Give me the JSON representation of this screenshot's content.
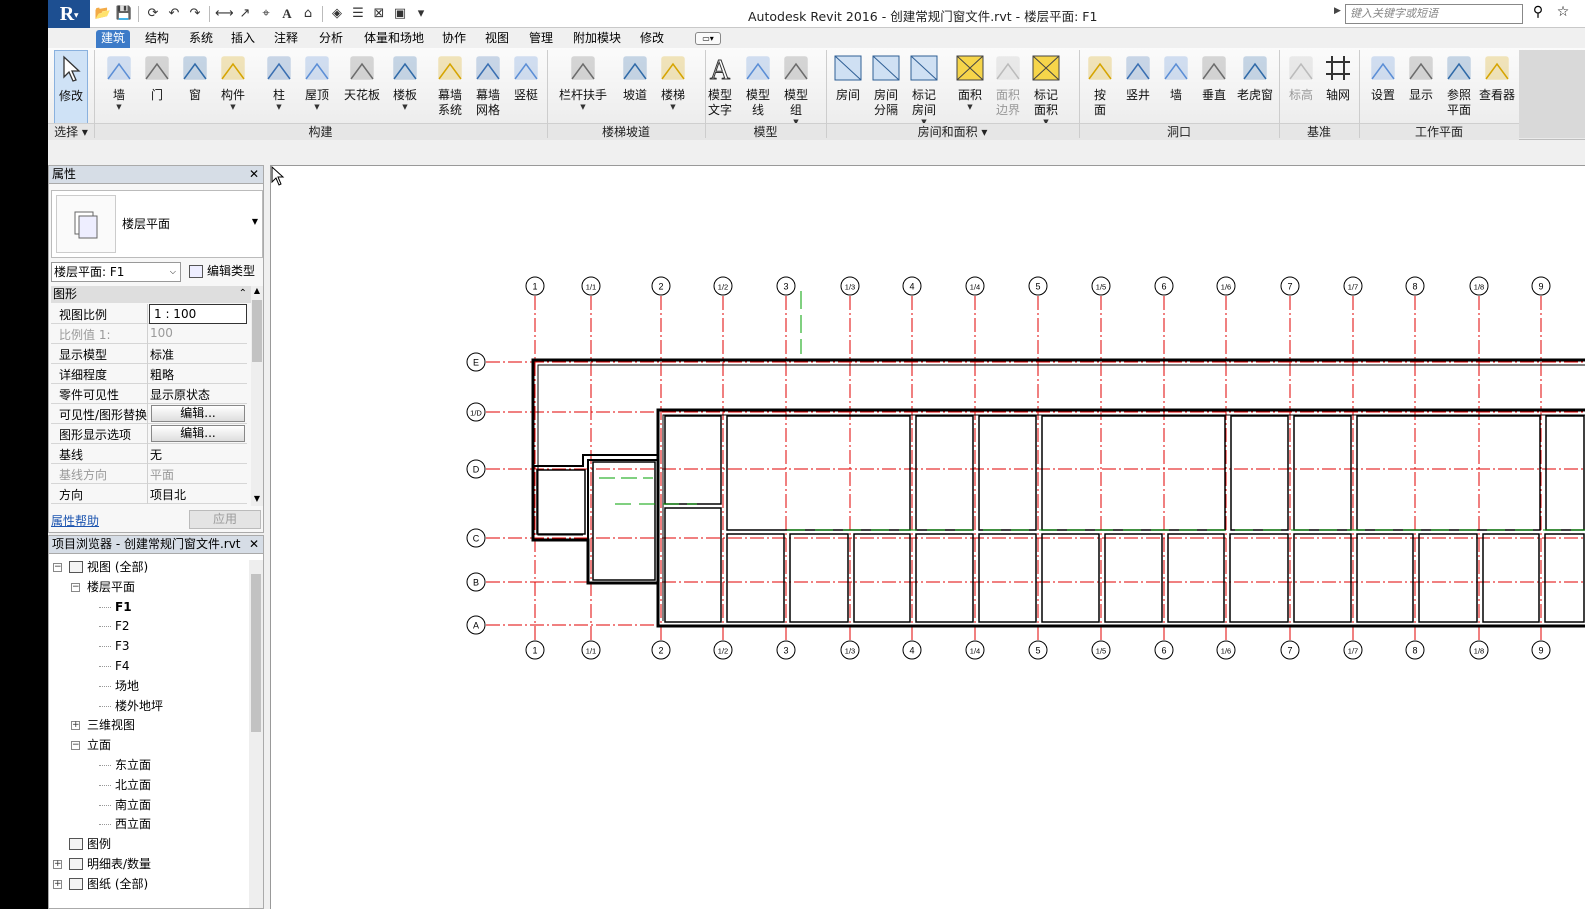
{
  "titlebar": {
    "app_initial": "R",
    "window_title": "Autodesk Revit 2016 -     创建常规门窗文件.rvt - 楼层平面: F1",
    "search_placeholder": "键入关键字或短语",
    "qat_icons": [
      "open-icon",
      "save-icon",
      "sync-icon",
      "undo-icon",
      "redo-icon",
      "measure-icon",
      "dimension-icon",
      "tag-icon",
      "text-icon",
      "3d-view-icon",
      "section-icon",
      "thin-lines-icon",
      "close-hidden-icon",
      "switch-windows-icon",
      "customize-icon"
    ]
  },
  "tabs": [
    {
      "label": "建筑",
      "active": true
    },
    {
      "label": "结构"
    },
    {
      "label": "系统"
    },
    {
      "label": "插入"
    },
    {
      "label": "注释"
    },
    {
      "label": "分析"
    },
    {
      "label": "体量和场地"
    },
    {
      "label": "协作"
    },
    {
      "label": "视图"
    },
    {
      "label": "管理"
    },
    {
      "label": "附加模块"
    },
    {
      "label": "修改"
    }
  ],
  "ribbon": {
    "buttons": [
      {
        "label": "修改",
        "icon": "modify-cursor-icon",
        "selected": true
      },
      {
        "label": "墙",
        "icon": "wall-icon",
        "dropdown": true
      },
      {
        "label": "门",
        "icon": "door-icon"
      },
      {
        "label": "窗",
        "icon": "window-icon"
      },
      {
        "label": "构件",
        "icon": "component-icon",
        "dropdown": true
      },
      {
        "label": "柱",
        "icon": "column-icon",
        "dropdown": true
      },
      {
        "label": "屋顶",
        "icon": "roof-icon",
        "dropdown": true
      },
      {
        "label": "天花板",
        "icon": "ceiling-icon"
      },
      {
        "label": "楼板",
        "icon": "floor-icon",
        "dropdown": true
      },
      {
        "label": "幕墙\n系统",
        "icon": "curtain-system-icon"
      },
      {
        "label": "幕墙\n网格",
        "icon": "curtain-grid-icon"
      },
      {
        "label": "竖梃",
        "icon": "mullion-icon"
      },
      {
        "label": "栏杆扶手",
        "icon": "railing-icon",
        "dropdown": true
      },
      {
        "label": "坡道",
        "icon": "ramp-icon"
      },
      {
        "label": "楼梯",
        "icon": "stair-icon",
        "dropdown": true
      },
      {
        "label": "模型\n文字",
        "icon": "model-text-icon"
      },
      {
        "label": "模型\n线",
        "icon": "model-line-icon"
      },
      {
        "label": "模型\n组",
        "icon": "model-group-icon",
        "dropdown": true
      },
      {
        "label": "房间",
        "icon": "room-icon"
      },
      {
        "label": "房间\n分隔",
        "icon": "room-separator-icon"
      },
      {
        "label": "标记\n房间",
        "icon": "tag-room-icon",
        "dropdown": true
      },
      {
        "label": "面积",
        "icon": "area-icon",
        "dropdown": true
      },
      {
        "label": "面积\n边界",
        "icon": "area-boundary-icon",
        "dim": true
      },
      {
        "label": "标记\n面积",
        "icon": "tag-area-icon",
        "dropdown": true
      },
      {
        "label": "按\n面",
        "icon": "by-face-icon"
      },
      {
        "label": "竖井",
        "icon": "shaft-icon"
      },
      {
        "label": "墙",
        "icon": "wall-opening-icon"
      },
      {
        "label": "垂直",
        "icon": "vertical-opening-icon"
      },
      {
        "label": "老虎窗",
        "icon": "dormer-icon"
      },
      {
        "label": "标高",
        "icon": "level-icon",
        "dim": true
      },
      {
        "label": "轴网",
        "icon": "grid-icon"
      },
      {
        "label": "设置",
        "icon": "set-workplane-icon"
      },
      {
        "label": "显示",
        "icon": "show-workplane-icon"
      },
      {
        "label": "参照\n平面",
        "icon": "ref-plane-icon"
      },
      {
        "label": "查看器",
        "icon": "viewer-icon"
      }
    ],
    "panels": [
      {
        "label": "选择 ▾"
      },
      {
        "label": "构建"
      },
      {
        "label": "楼梯坡道"
      },
      {
        "label": "模型"
      },
      {
        "label": "房间和面积 ▾"
      },
      {
        "label": "洞口"
      },
      {
        "label": "基准"
      },
      {
        "label": "工作平面"
      }
    ]
  },
  "properties": {
    "title": "属性",
    "type_name": "楼层平面",
    "instance_selector": "楼层平面: F1",
    "edit_type": "编辑类型",
    "group_header": "图形",
    "rows": [
      {
        "key": "视图比例",
        "value": "1 : 100",
        "boxed": true
      },
      {
        "key": "比例值 1:",
        "value": "100",
        "dim": true
      },
      {
        "key": "显示模型",
        "value": "标准"
      },
      {
        "key": "详细程度",
        "value": "粗略"
      },
      {
        "key": "零件可见性",
        "value": "显示原状态"
      },
      {
        "key": "可见性/图形替换",
        "value": "编辑...",
        "button": true
      },
      {
        "key": "图形显示选项",
        "value": "编辑...",
        "button": true
      },
      {
        "key": "基线",
        "value": "无"
      },
      {
        "key": "基线方向",
        "value": "平面",
        "dim": true
      },
      {
        "key": "方向",
        "value": "项目北"
      }
    ],
    "help_link": "属性帮助",
    "apply_label": "应用"
  },
  "browser": {
    "title": "项目浏览器 - 创建常规门窗文件.rvt",
    "nodes": [
      {
        "label": "视图 (全部)",
        "level": 0,
        "expander": "−",
        "icon": true
      },
      {
        "label": "楼层平面",
        "level": 1,
        "expander": "−"
      },
      {
        "label": "F1",
        "level": 2,
        "bold": true
      },
      {
        "label": "F2",
        "level": 2
      },
      {
        "label": "F3",
        "level": 2
      },
      {
        "label": "F4",
        "level": 2
      },
      {
        "label": "场地",
        "level": 2
      },
      {
        "label": "楼外地坪",
        "level": 2
      },
      {
        "label": "三维视图",
        "level": 1,
        "expander": "+"
      },
      {
        "label": "立面",
        "level": 1,
        "expander": "−"
      },
      {
        "label": "东立面",
        "level": 2
      },
      {
        "label": "北立面",
        "level": 2
      },
      {
        "label": "南立面",
        "level": 2
      },
      {
        "label": "西立面",
        "level": 2
      },
      {
        "label": "图例",
        "level": 0,
        "icon": true
      },
      {
        "label": "明细表/数量",
        "level": 0,
        "expander": "+",
        "icon": true
      },
      {
        "label": "图纸 (全部)",
        "level": 0,
        "expander": "+",
        "icon": true
      }
    ]
  },
  "plan": {
    "vertical_grids": [
      "1",
      "1/1",
      "2",
      "1/2",
      "3",
      "1/3",
      "4",
      "1/4",
      "5",
      "1/5",
      "6",
      "1/6",
      "7",
      "1/7",
      "8",
      "1/8",
      "9"
    ],
    "horizontal_grids": [
      "E",
      "1/D",
      "D",
      "C",
      "B",
      "A"
    ],
    "grid_color": "#e00000",
    "wall_color": "#000000",
    "hidden_line_color": "#00a000"
  }
}
